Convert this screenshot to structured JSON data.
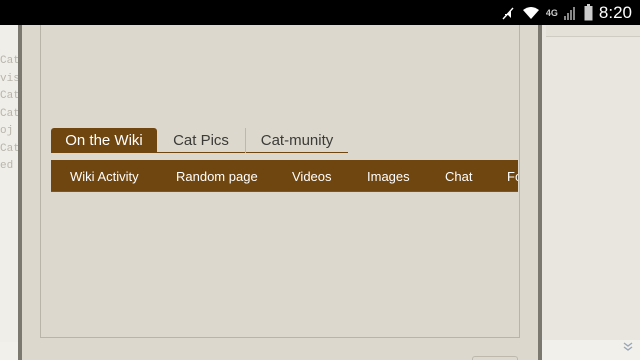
{
  "status_bar": {
    "time": "8:20",
    "network": "4G",
    "icons": [
      "mute-icon",
      "wifi-icon",
      "signal-icon",
      "battery-icon"
    ]
  },
  "background": {
    "left_text_stubs": [
      "Cat",
      "vis",
      "Cat",
      "Cat",
      "oj",
      "Cat",
      "ed"
    ]
  },
  "tabs": [
    {
      "label": "On the Wiki",
      "active": true
    },
    {
      "label": "Cat Pics",
      "active": false
    },
    {
      "label": "Cat-munity",
      "active": false
    }
  ],
  "nav": {
    "items": [
      {
        "label": "Wiki Activity"
      },
      {
        "label": "Random page"
      },
      {
        "label": "Videos"
      },
      {
        "label": "Images"
      },
      {
        "label": "Chat"
      },
      {
        "label": "Fo"
      }
    ]
  },
  "colors": {
    "accent": "#704610",
    "modal_bg": "#dcd8ce",
    "statusbar": "#000000"
  }
}
